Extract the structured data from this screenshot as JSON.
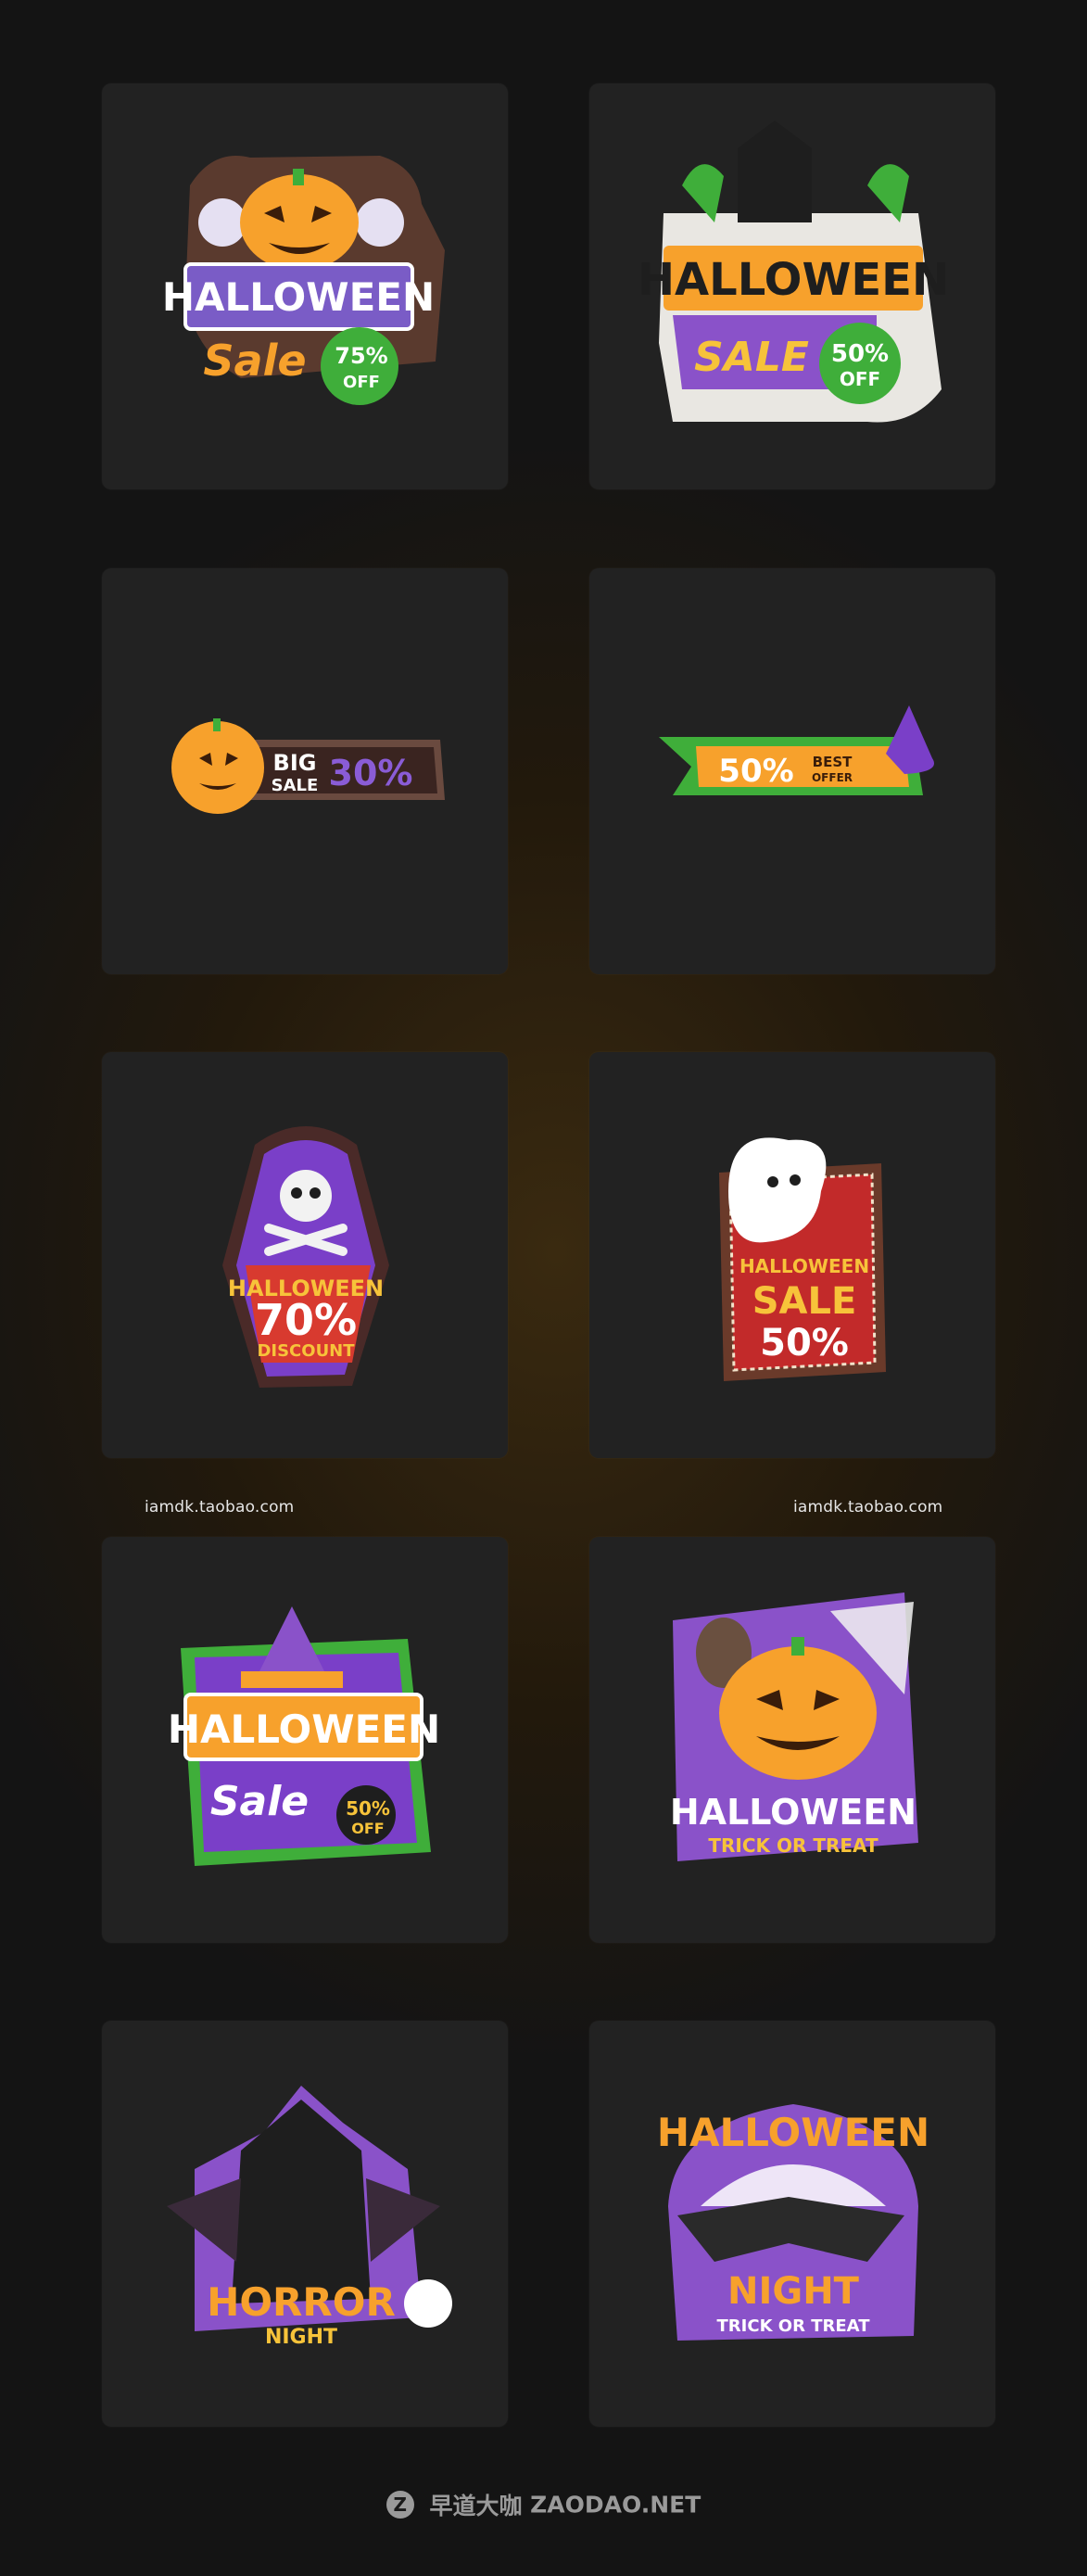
{
  "stickers": [
    {
      "title": "HALLOWEEN",
      "sub": "Sale",
      "pct": "75%",
      "off": "OFF"
    },
    {
      "title": "HALLOWEEN",
      "sub": "SALE",
      "pct": "50%",
      "off": "OFF"
    },
    {
      "big": "BIG",
      "sale": "SALE",
      "pct": "30%"
    },
    {
      "pct": "50%",
      "best": "BEST",
      "offer": "OFFER"
    },
    {
      "title": "HALLOWEEN",
      "pct": "70%",
      "sub": "DISCOUNT"
    },
    {
      "title": "HALLOWEEN",
      "sale": "SALE",
      "pct": "50%"
    },
    {
      "title": "HALLOWEEN",
      "sub": "Sale",
      "pct": "50%",
      "off": "OFF"
    },
    {
      "title": "HALLOWEEN",
      "sub": "TRICK OR TREAT"
    },
    {
      "title": "HORROR",
      "sub": "NIGHT"
    },
    {
      "title": "HALLOWEEN",
      "night": "NIGHT",
      "sub": "TRICK OR TREAT"
    }
  ],
  "watermarks": {
    "left": "iamdk.taobao.com",
    "right": "iamdk.taobao.com"
  },
  "footer": {
    "logo": "Z",
    "cn": "早道大咖",
    "brand": "ZAODAO.NET"
  },
  "colors": {
    "tile": "#222222",
    "orange": "#f7a12c",
    "purple": "#7a3fc8",
    "green": "#3fae3a"
  }
}
